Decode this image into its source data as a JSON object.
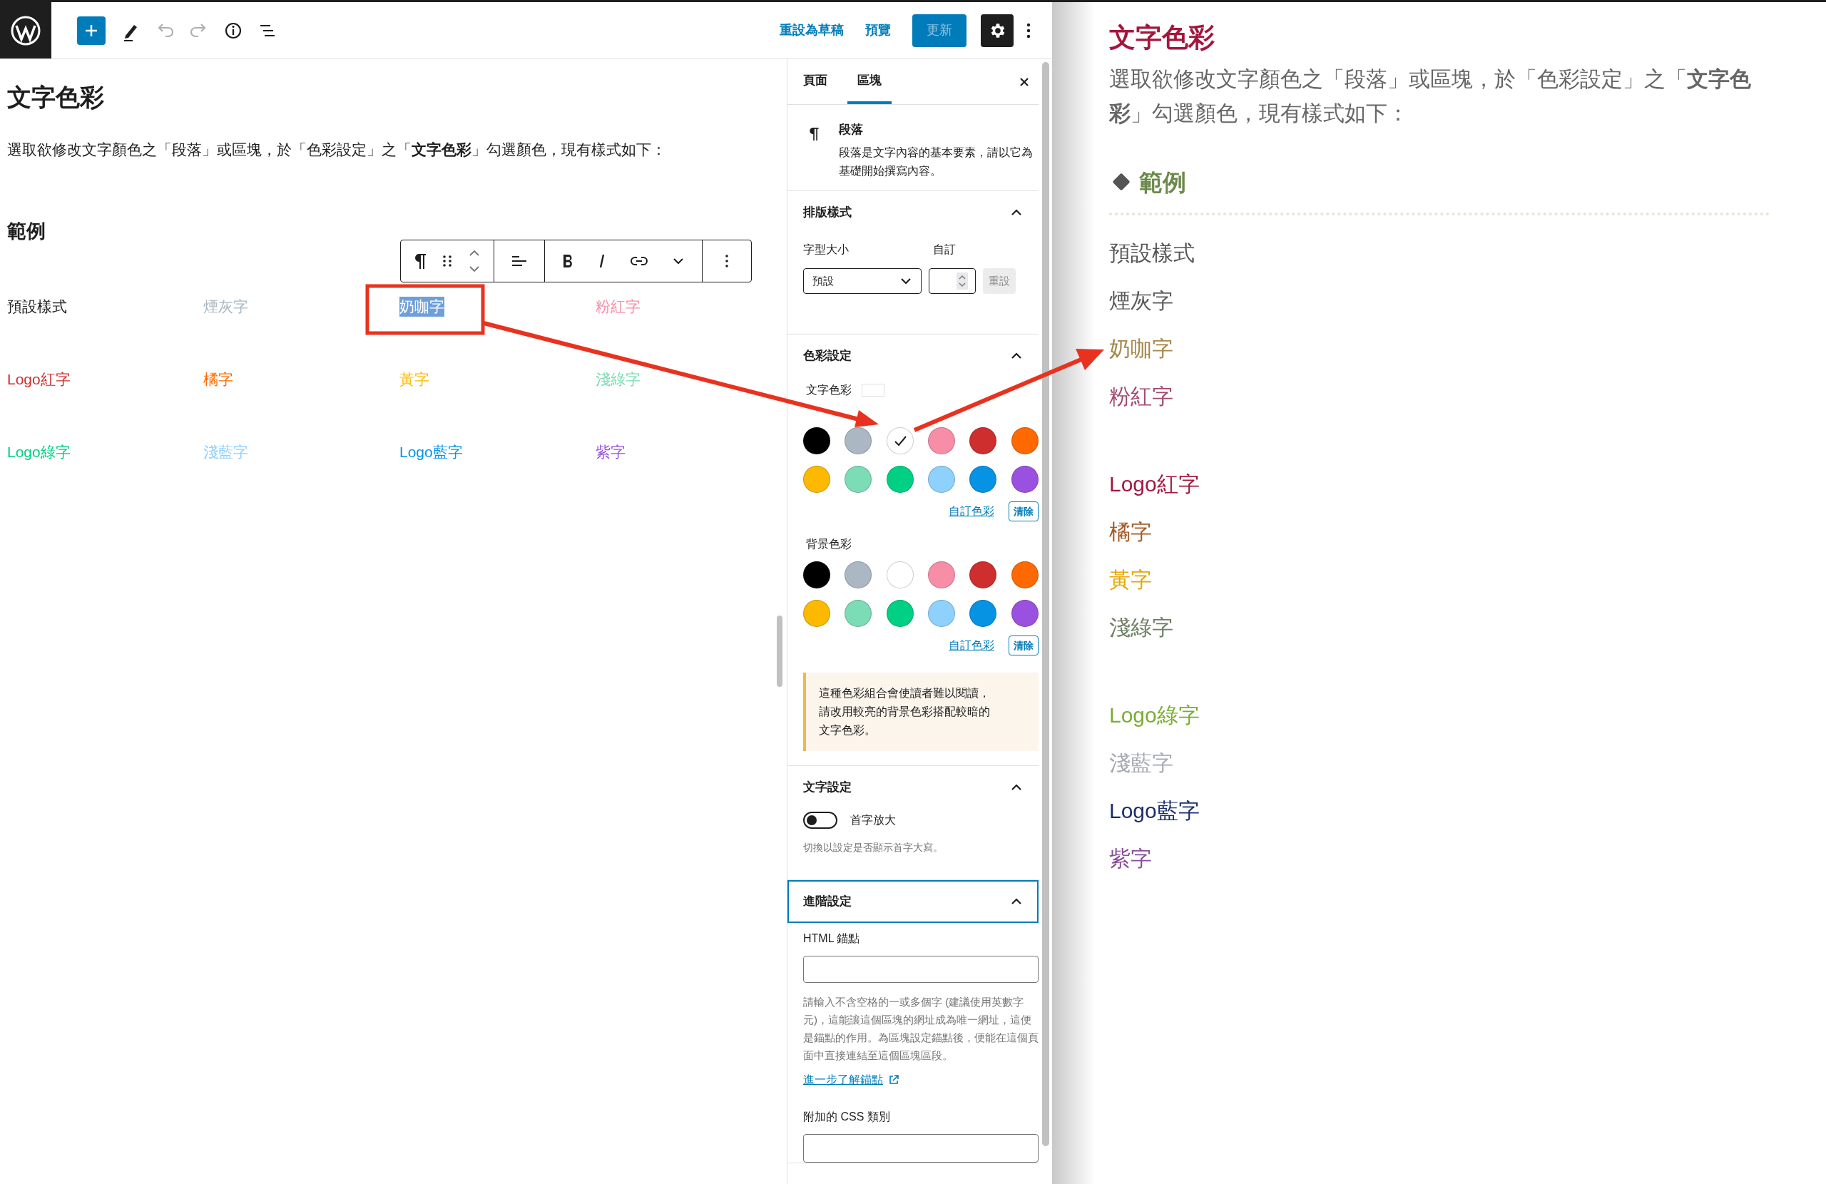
{
  "topbar": {
    "actions": [
      {
        "label": "重設為草稿",
        "kind": "link",
        "disabled": false
      },
      {
        "label": "預覽",
        "kind": "link",
        "disabled": false
      },
      {
        "label": "更新",
        "kind": "primary",
        "disabled": true
      }
    ]
  },
  "editor": {
    "title": "文字色彩",
    "intro": "選取欲修改文字顏色之「段落」或區塊，於「色彩設定」之「**文字色彩**」勾選顏色，現有樣式如下：",
    "heading": "範例",
    "samples": [
      {
        "text": "預設樣式",
        "color": "#1e1e1e",
        "selected": false
      },
      {
        "text": "煙灰字",
        "color": "#abb8c3",
        "selected": false
      },
      {
        "text": "奶咖字",
        "selected": true
      },
      {
        "text": "粉紅字",
        "color": "#f78da7",
        "selected": false
      },
      {
        "text": "Logo紅字",
        "color": "#cf2e2e",
        "selected": false
      },
      {
        "text": "橘字",
        "color": "#ff6900",
        "selected": false
      },
      {
        "text": "黃字",
        "color": "#fcb900",
        "selected": false
      },
      {
        "text": "淺綠字",
        "color": "#7bdcb5",
        "selected": false
      },
      {
        "text": "Logo綠字",
        "color": "#00d084",
        "selected": false
      },
      {
        "text": "淺藍字",
        "color": "#8ed1fc",
        "selected": false
      },
      {
        "text": "Logo藍字",
        "color": "#0693e3",
        "selected": false
      },
      {
        "text": "紫字",
        "color": "#9b51e0",
        "selected": false
      }
    ]
  },
  "sidebar": {
    "tabs": [
      {
        "label": "頁面",
        "selected": false
      },
      {
        "label": "區塊",
        "selected": true
      }
    ],
    "block": {
      "name": "段落",
      "description": "段落是文字內容的基本要素，請以它為基礎開始撰寫內容。"
    },
    "panels": [
      {
        "kind": "typography",
        "title": "排版樣式",
        "expanded": true,
        "focused": false,
        "font_size_label": "字型大小",
        "font_size_value": "預設",
        "custom_label": "自訂",
        "reset_button": "重設"
      },
      {
        "kind": "color",
        "title": "色彩設定",
        "expanded": true,
        "focused": false,
        "palettes": [
          {
            "label": "文字色彩",
            "custom_link": "自訂色彩",
            "clear_button": "清除",
            "swatches": [
              {
                "color": "#000000",
                "selected": false
              },
              {
                "color": "#abb8c3",
                "selected": false
              },
              {
                "color": "#ffffff",
                "selected": true
              },
              {
                "color": "#f78da7",
                "selected": false
              },
              {
                "color": "#cf2e2e",
                "selected": false
              },
              {
                "color": "#ff6900",
                "selected": false
              },
              {
                "color": "#fcb900",
                "selected": false
              },
              {
                "color": "#7bdcb5",
                "selected": false
              },
              {
                "color": "#00d084",
                "selected": false
              },
              {
                "color": "#8ed1fc",
                "selected": false
              },
              {
                "color": "#0693e3",
                "selected": false
              },
              {
                "color": "#9b51e0",
                "selected": false
              }
            ]
          },
          {
            "label": "背景色彩",
            "custom_link": "自訂色彩",
            "clear_button": "清除",
            "swatches": [
              {
                "color": "#000000",
                "selected": false
              },
              {
                "color": "#abb8c3",
                "selected": false
              },
              {
                "color": "#ffffff",
                "selected": false
              },
              {
                "color": "#f78da7",
                "selected": false
              },
              {
                "color": "#cf2e2e",
                "selected": false
              },
              {
                "color": "#ff6900",
                "selected": false
              },
              {
                "color": "#fcb900",
                "selected": false
              },
              {
                "color": "#7bdcb5",
                "selected": false
              },
              {
                "color": "#00d084",
                "selected": false
              },
              {
                "color": "#8ed1fc",
                "selected": false
              },
              {
                "color": "#0693e3",
                "selected": false
              },
              {
                "color": "#9b51e0",
                "selected": false
              }
            ]
          }
        ],
        "notice": "這種色彩組合會使讀者難以閱讀，請改用較亮的背景色彩搭配較暗的文字色彩。"
      },
      {
        "kind": "text",
        "title": "文字設定",
        "expanded": true,
        "focused": false,
        "toggle_label": "首字放大",
        "on": false,
        "help": "切換以設定是否顯示首字大寫。"
      },
      {
        "kind": "advanced",
        "title": "進階設定",
        "expanded": true,
        "focused": true,
        "anchor_label": "HTML 錨點",
        "anchor_help": "請輸入不含空格的一或多個字 (建議使用英數字元)，這能讓這個區塊的網址成為唯一網址，這便是錨點的作用。為區塊設定錨點後，便能在這個頁面中直接連結至這個區塊區段。",
        "learn_more": "進一步了解錨點",
        "css_label": "附加的 CSS 類別"
      }
    ]
  },
  "preview": {
    "title": "文字色彩",
    "intro": "選取欲修改文字顏色之「段落」或區塊，於「色彩設定」之「**文字色彩**」勾選顏色，現有樣式如下：",
    "heading": "範例",
    "groups": [
      [
        {
          "text": "預設樣式",
          "color": "#555555"
        },
        {
          "text": "煙灰字",
          "color": "#5c5c5c"
        },
        {
          "text": "奶咖字",
          "color": "#a5884c"
        },
        {
          "text": "粉紅字",
          "color": "#a04a6e"
        }
      ],
      [
        {
          "text": "Logo紅字",
          "color": "#a3173d"
        },
        {
          "text": "橘字",
          "color": "#a45c26"
        },
        {
          "text": "黃字",
          "color": "#e6a700"
        },
        {
          "text": "淺綠字",
          "color": "#6d7f62"
        }
      ],
      [
        {
          "text": "Logo綠字",
          "color": "#79ad32"
        },
        {
          "text": "淺藍字",
          "color": "#a7aab4"
        },
        {
          "text": "Logo藍字",
          "color": "#1a2e6a"
        },
        {
          "text": "紫字",
          "color": "#8a4f9c"
        }
      ]
    ]
  }
}
